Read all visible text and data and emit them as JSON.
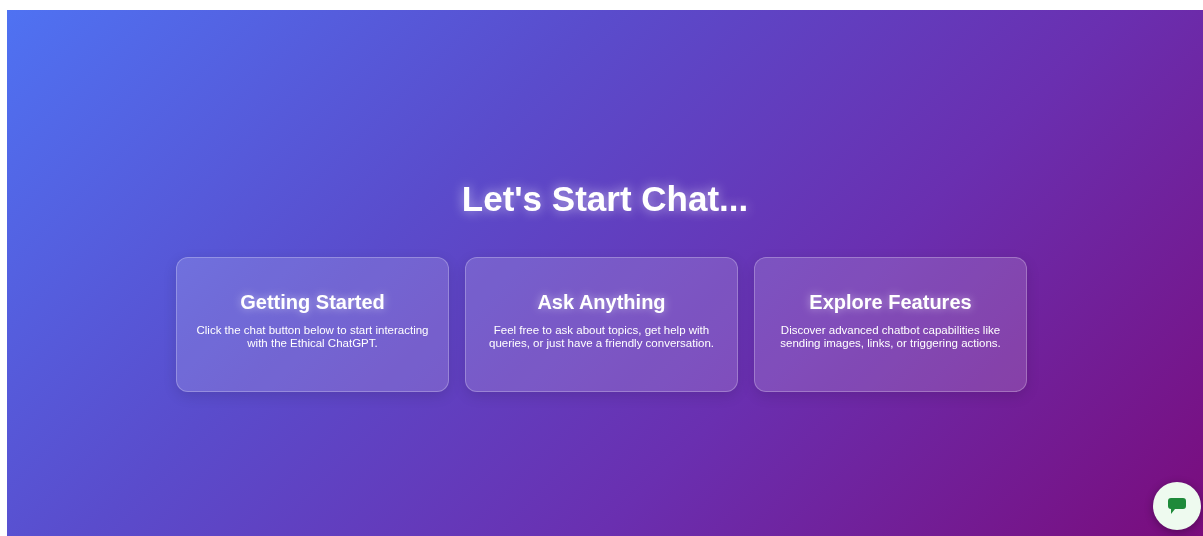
{
  "heading": "Let's Start Chat...",
  "cards": [
    {
      "title": "Getting Started",
      "text": "Click the chat button below to start interacting with the Ethical ChatGPT."
    },
    {
      "title": "Ask Anything",
      "text": "Feel free to ask about topics, get help with queries, or just have a friendly conversation."
    },
    {
      "title": "Explore Features",
      "text": "Discover advanced chatbot capabilities like sending images, links, or triggering actions."
    }
  ]
}
